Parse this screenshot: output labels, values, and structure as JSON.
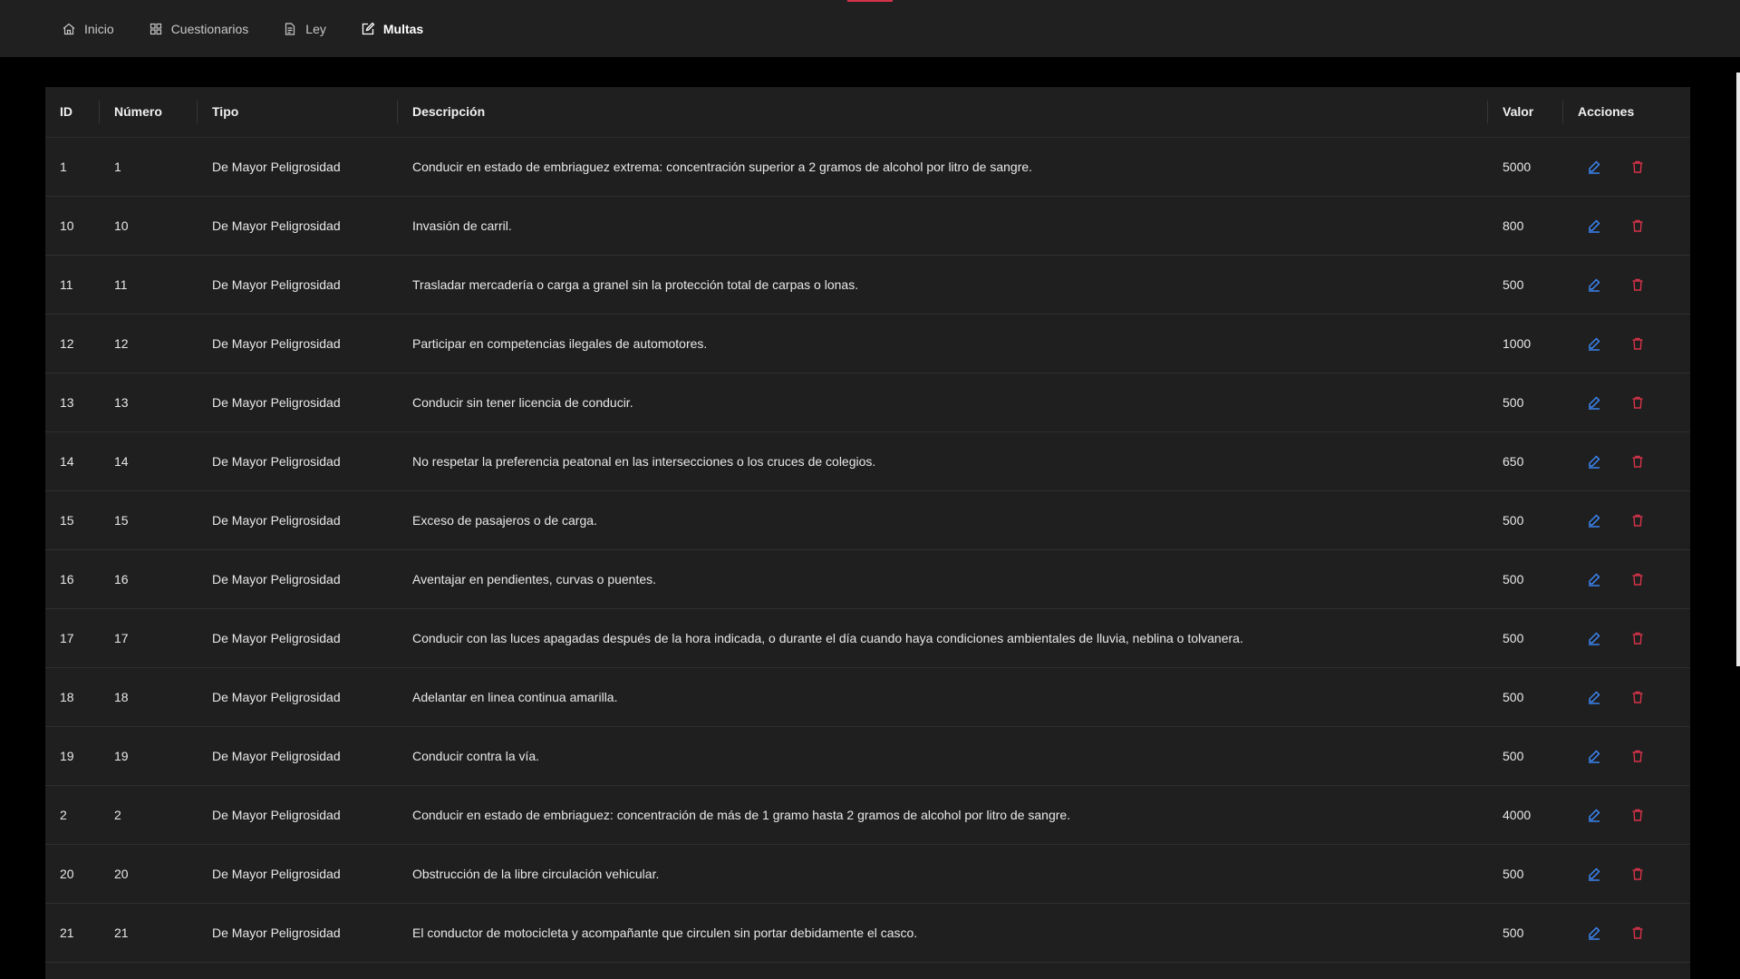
{
  "nav": {
    "items": [
      {
        "label": "Inicio",
        "icon": "home-icon"
      },
      {
        "label": "Cuestionarios",
        "icon": "grid-icon"
      },
      {
        "label": "Ley",
        "icon": "document-icon"
      },
      {
        "label": "Multas",
        "icon": "edit-square-icon",
        "active": true
      }
    ]
  },
  "colors": {
    "accent": "#d6334a",
    "edit": "#3d8bff",
    "delete": "#d6334a",
    "background": "#000000",
    "surface": "#1f1f1f"
  },
  "table": {
    "headers": [
      "ID",
      "Número",
      "Tipo",
      "Descripción",
      "Valor",
      "Acciones"
    ],
    "rows": [
      {
        "id": "1",
        "numero": "1",
        "tipo": "De Mayor Peligrosidad",
        "descripcion": "Conducir en estado de embriaguez extrema: concentración superior a 2 gramos de alcohol por litro de sangre.",
        "valor": "5000"
      },
      {
        "id": "10",
        "numero": "10",
        "tipo": "De Mayor Peligrosidad",
        "descripcion": "Invasión de carril.",
        "valor": "800"
      },
      {
        "id": "11",
        "numero": "11",
        "tipo": "De Mayor Peligrosidad",
        "descripcion": "Trasladar mercadería o carga a granel sin la protección total de carpas o lonas.",
        "valor": "500"
      },
      {
        "id": "12",
        "numero": "12",
        "tipo": "De Mayor Peligrosidad",
        "descripcion": "Participar en competencias ilegales de automotores.",
        "valor": "1000"
      },
      {
        "id": "13",
        "numero": "13",
        "tipo": "De Mayor Peligrosidad",
        "descripcion": "Conducir sin tener licencia de conducir.",
        "valor": "500"
      },
      {
        "id": "14",
        "numero": "14",
        "tipo": "De Mayor Peligrosidad",
        "descripcion": "No respetar la preferencia peatonal en las intersecciones o los cruces de colegios.",
        "valor": "650"
      },
      {
        "id": "15",
        "numero": "15",
        "tipo": "De Mayor Peligrosidad",
        "descripcion": "Exceso de pasajeros o de carga.",
        "valor": "500"
      },
      {
        "id": "16",
        "numero": "16",
        "tipo": "De Mayor Peligrosidad",
        "descripcion": "Aventajar en pendientes, curvas o puentes.",
        "valor": "500"
      },
      {
        "id": "17",
        "numero": "17",
        "tipo": "De Mayor Peligrosidad",
        "descripcion": "Conducir con las luces apagadas después de la hora indicada, o durante el día cuando haya condiciones ambientales de lluvia, neblina o tolvanera.",
        "valor": "500"
      },
      {
        "id": "18",
        "numero": "18",
        "tipo": "De Mayor Peligrosidad",
        "descripcion": "Adelantar en linea continua amarilla.",
        "valor": "500"
      },
      {
        "id": "19",
        "numero": "19",
        "tipo": "De Mayor Peligrosidad",
        "descripcion": "Conducir contra la vía.",
        "valor": "500"
      },
      {
        "id": "2",
        "numero": "2",
        "tipo": "De Mayor Peligrosidad",
        "descripcion": "Conducir en estado de embriaguez: concentración de más de 1 gramo hasta 2 gramos de alcohol por litro de sangre.",
        "valor": "4000"
      },
      {
        "id": "20",
        "numero": "20",
        "tipo": "De Mayor Peligrosidad",
        "descripcion": "Obstrucción de la libre circulación vehicular.",
        "valor": "500"
      },
      {
        "id": "21",
        "numero": "21",
        "tipo": "De Mayor Peligrosidad",
        "descripcion": "El conductor de motocicleta y acompañante que circulen sin portar debidamente el casco.",
        "valor": "500"
      }
    ]
  }
}
